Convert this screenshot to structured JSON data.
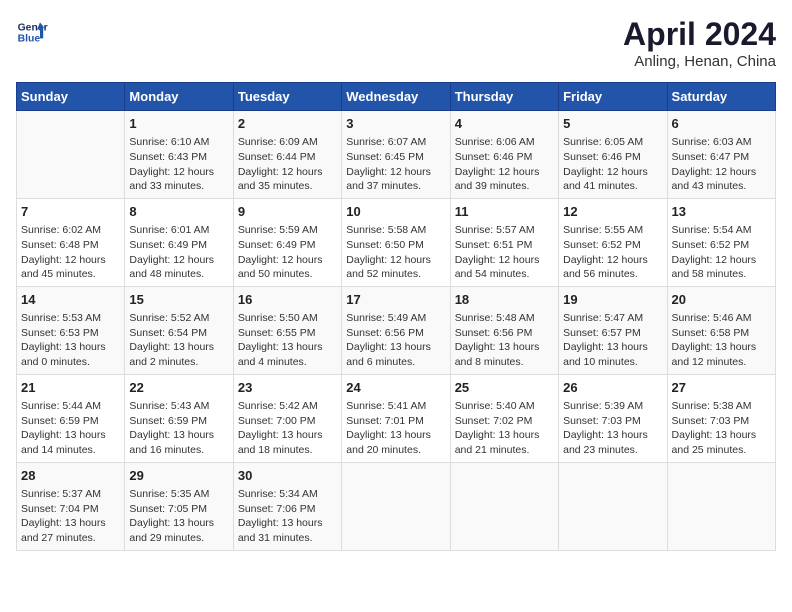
{
  "header": {
    "logo_line1": "General",
    "logo_line2": "Blue",
    "title": "April 2024",
    "subtitle": "Anling, Henan, China"
  },
  "columns": [
    "Sunday",
    "Monday",
    "Tuesday",
    "Wednesday",
    "Thursday",
    "Friday",
    "Saturday"
  ],
  "weeks": [
    [
      {
        "day": "",
        "info": ""
      },
      {
        "day": "1",
        "info": "Sunrise: 6:10 AM\nSunset: 6:43 PM\nDaylight: 12 hours\nand 33 minutes."
      },
      {
        "day": "2",
        "info": "Sunrise: 6:09 AM\nSunset: 6:44 PM\nDaylight: 12 hours\nand 35 minutes."
      },
      {
        "day": "3",
        "info": "Sunrise: 6:07 AM\nSunset: 6:45 PM\nDaylight: 12 hours\nand 37 minutes."
      },
      {
        "day": "4",
        "info": "Sunrise: 6:06 AM\nSunset: 6:46 PM\nDaylight: 12 hours\nand 39 minutes."
      },
      {
        "day": "5",
        "info": "Sunrise: 6:05 AM\nSunset: 6:46 PM\nDaylight: 12 hours\nand 41 minutes."
      },
      {
        "day": "6",
        "info": "Sunrise: 6:03 AM\nSunset: 6:47 PM\nDaylight: 12 hours\nand 43 minutes."
      }
    ],
    [
      {
        "day": "7",
        "info": "Sunrise: 6:02 AM\nSunset: 6:48 PM\nDaylight: 12 hours\nand 45 minutes."
      },
      {
        "day": "8",
        "info": "Sunrise: 6:01 AM\nSunset: 6:49 PM\nDaylight: 12 hours\nand 48 minutes."
      },
      {
        "day": "9",
        "info": "Sunrise: 5:59 AM\nSunset: 6:49 PM\nDaylight: 12 hours\nand 50 minutes."
      },
      {
        "day": "10",
        "info": "Sunrise: 5:58 AM\nSunset: 6:50 PM\nDaylight: 12 hours\nand 52 minutes."
      },
      {
        "day": "11",
        "info": "Sunrise: 5:57 AM\nSunset: 6:51 PM\nDaylight: 12 hours\nand 54 minutes."
      },
      {
        "day": "12",
        "info": "Sunrise: 5:55 AM\nSunset: 6:52 PM\nDaylight: 12 hours\nand 56 minutes."
      },
      {
        "day": "13",
        "info": "Sunrise: 5:54 AM\nSunset: 6:52 PM\nDaylight: 12 hours\nand 58 minutes."
      }
    ],
    [
      {
        "day": "14",
        "info": "Sunrise: 5:53 AM\nSunset: 6:53 PM\nDaylight: 13 hours\nand 0 minutes."
      },
      {
        "day": "15",
        "info": "Sunrise: 5:52 AM\nSunset: 6:54 PM\nDaylight: 13 hours\nand 2 minutes."
      },
      {
        "day": "16",
        "info": "Sunrise: 5:50 AM\nSunset: 6:55 PM\nDaylight: 13 hours\nand 4 minutes."
      },
      {
        "day": "17",
        "info": "Sunrise: 5:49 AM\nSunset: 6:56 PM\nDaylight: 13 hours\nand 6 minutes."
      },
      {
        "day": "18",
        "info": "Sunrise: 5:48 AM\nSunset: 6:56 PM\nDaylight: 13 hours\nand 8 minutes."
      },
      {
        "day": "19",
        "info": "Sunrise: 5:47 AM\nSunset: 6:57 PM\nDaylight: 13 hours\nand 10 minutes."
      },
      {
        "day": "20",
        "info": "Sunrise: 5:46 AM\nSunset: 6:58 PM\nDaylight: 13 hours\nand 12 minutes."
      }
    ],
    [
      {
        "day": "21",
        "info": "Sunrise: 5:44 AM\nSunset: 6:59 PM\nDaylight: 13 hours\nand 14 minutes."
      },
      {
        "day": "22",
        "info": "Sunrise: 5:43 AM\nSunset: 6:59 PM\nDaylight: 13 hours\nand 16 minutes."
      },
      {
        "day": "23",
        "info": "Sunrise: 5:42 AM\nSunset: 7:00 PM\nDaylight: 13 hours\nand 18 minutes."
      },
      {
        "day": "24",
        "info": "Sunrise: 5:41 AM\nSunset: 7:01 PM\nDaylight: 13 hours\nand 20 minutes."
      },
      {
        "day": "25",
        "info": "Sunrise: 5:40 AM\nSunset: 7:02 PM\nDaylight: 13 hours\nand 21 minutes."
      },
      {
        "day": "26",
        "info": "Sunrise: 5:39 AM\nSunset: 7:03 PM\nDaylight: 13 hours\nand 23 minutes."
      },
      {
        "day": "27",
        "info": "Sunrise: 5:38 AM\nSunset: 7:03 PM\nDaylight: 13 hours\nand 25 minutes."
      }
    ],
    [
      {
        "day": "28",
        "info": "Sunrise: 5:37 AM\nSunset: 7:04 PM\nDaylight: 13 hours\nand 27 minutes."
      },
      {
        "day": "29",
        "info": "Sunrise: 5:35 AM\nSunset: 7:05 PM\nDaylight: 13 hours\nand 29 minutes."
      },
      {
        "day": "30",
        "info": "Sunrise: 5:34 AM\nSunset: 7:06 PM\nDaylight: 13 hours\nand 31 minutes."
      },
      {
        "day": "",
        "info": ""
      },
      {
        "day": "",
        "info": ""
      },
      {
        "day": "",
        "info": ""
      },
      {
        "day": "",
        "info": ""
      }
    ]
  ]
}
